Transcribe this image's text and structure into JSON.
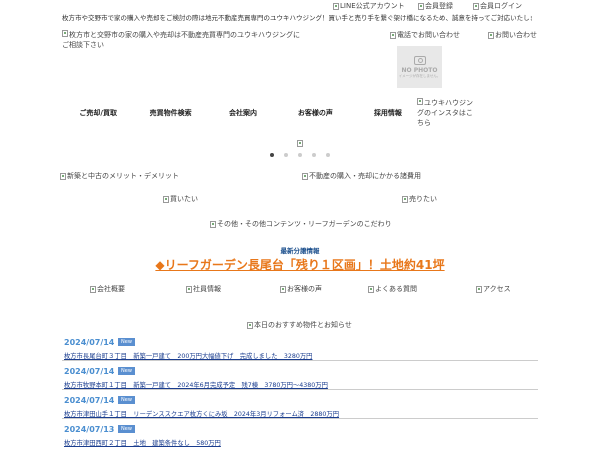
{
  "header": {
    "tagline": "枚方市や交野市で家の購入や売却をご検討の際は地元不動産売買専門のユウキハウジング！買い手と売り手を繋ぐ架け橋になるため、誠意を持ってご対応いたします。",
    "line_account": "LINE公式アカウント",
    "member_register": "会員登録",
    "member_login": "会員ログイン",
    "logo_alt": "枚方市と交野市の家の購入や売却は不動産売買専門のユウキハウジングにご相談下さい",
    "phone_contact": "電話でお問い合わせ",
    "contact": "お問い合わせ",
    "no_photo": "NO PHOTO",
    "no_photo_sub": "イメージが存在しません。",
    "instagram": "ユウキハウジングのインスタはこちら"
  },
  "nav": {
    "items": [
      "ご売却/買取",
      "売買物件検索",
      "会社案内",
      "お客様の声",
      "採用情報"
    ]
  },
  "slider": {
    "dot_count": 5,
    "active_index": 0
  },
  "banners": {
    "merit": "新築と中古のメリット・デメリット",
    "cost": "不動産の購入・売却にかかる諸費用",
    "buy": "買いたい",
    "sell": "売りたい",
    "contents": "その他・その他コンテンツ・リーフガーデンのこだわり"
  },
  "latest": {
    "label": "最新分譲情報",
    "headline": "◆リーフガーデン長尾台「残り１区画」！土地約41坪"
  },
  "quick_links": [
    "会社概要",
    "社員情報",
    "お客様の声",
    "よくある質問",
    "アクセス"
  ],
  "news": {
    "heading": "本日のおすすめ物件とお知らせ",
    "items": [
      {
        "date": "2024/07/14",
        "badge": "New",
        "title": "枚方市長尾台町３丁目　新築一戸建て　200万円大幅値下げ　完成しました　3280万円"
      },
      {
        "date": "2024/07/14",
        "badge": "New",
        "title": "枚方市牧野本町１丁目　新築一戸建て　2024年6月完成予定　残7棟　3780万円～4380万円"
      },
      {
        "date": "2024/07/14",
        "badge": "New",
        "title": "枚方市津田山手１丁目　リーデンススクエア枚方くにみ坂　2024年3月リフォーム済　2880万円"
      },
      {
        "date": "2024/07/13",
        "badge": "New",
        "title": "枚方市津田西町２丁目　土地　建築条件なし　580万円"
      }
    ]
  },
  "colors": {
    "date_blue": "#4a8ed0",
    "link_blue": "#1a3d8f",
    "accent_orange": "#e8771a",
    "badge_blue": "#5a8fd0"
  }
}
